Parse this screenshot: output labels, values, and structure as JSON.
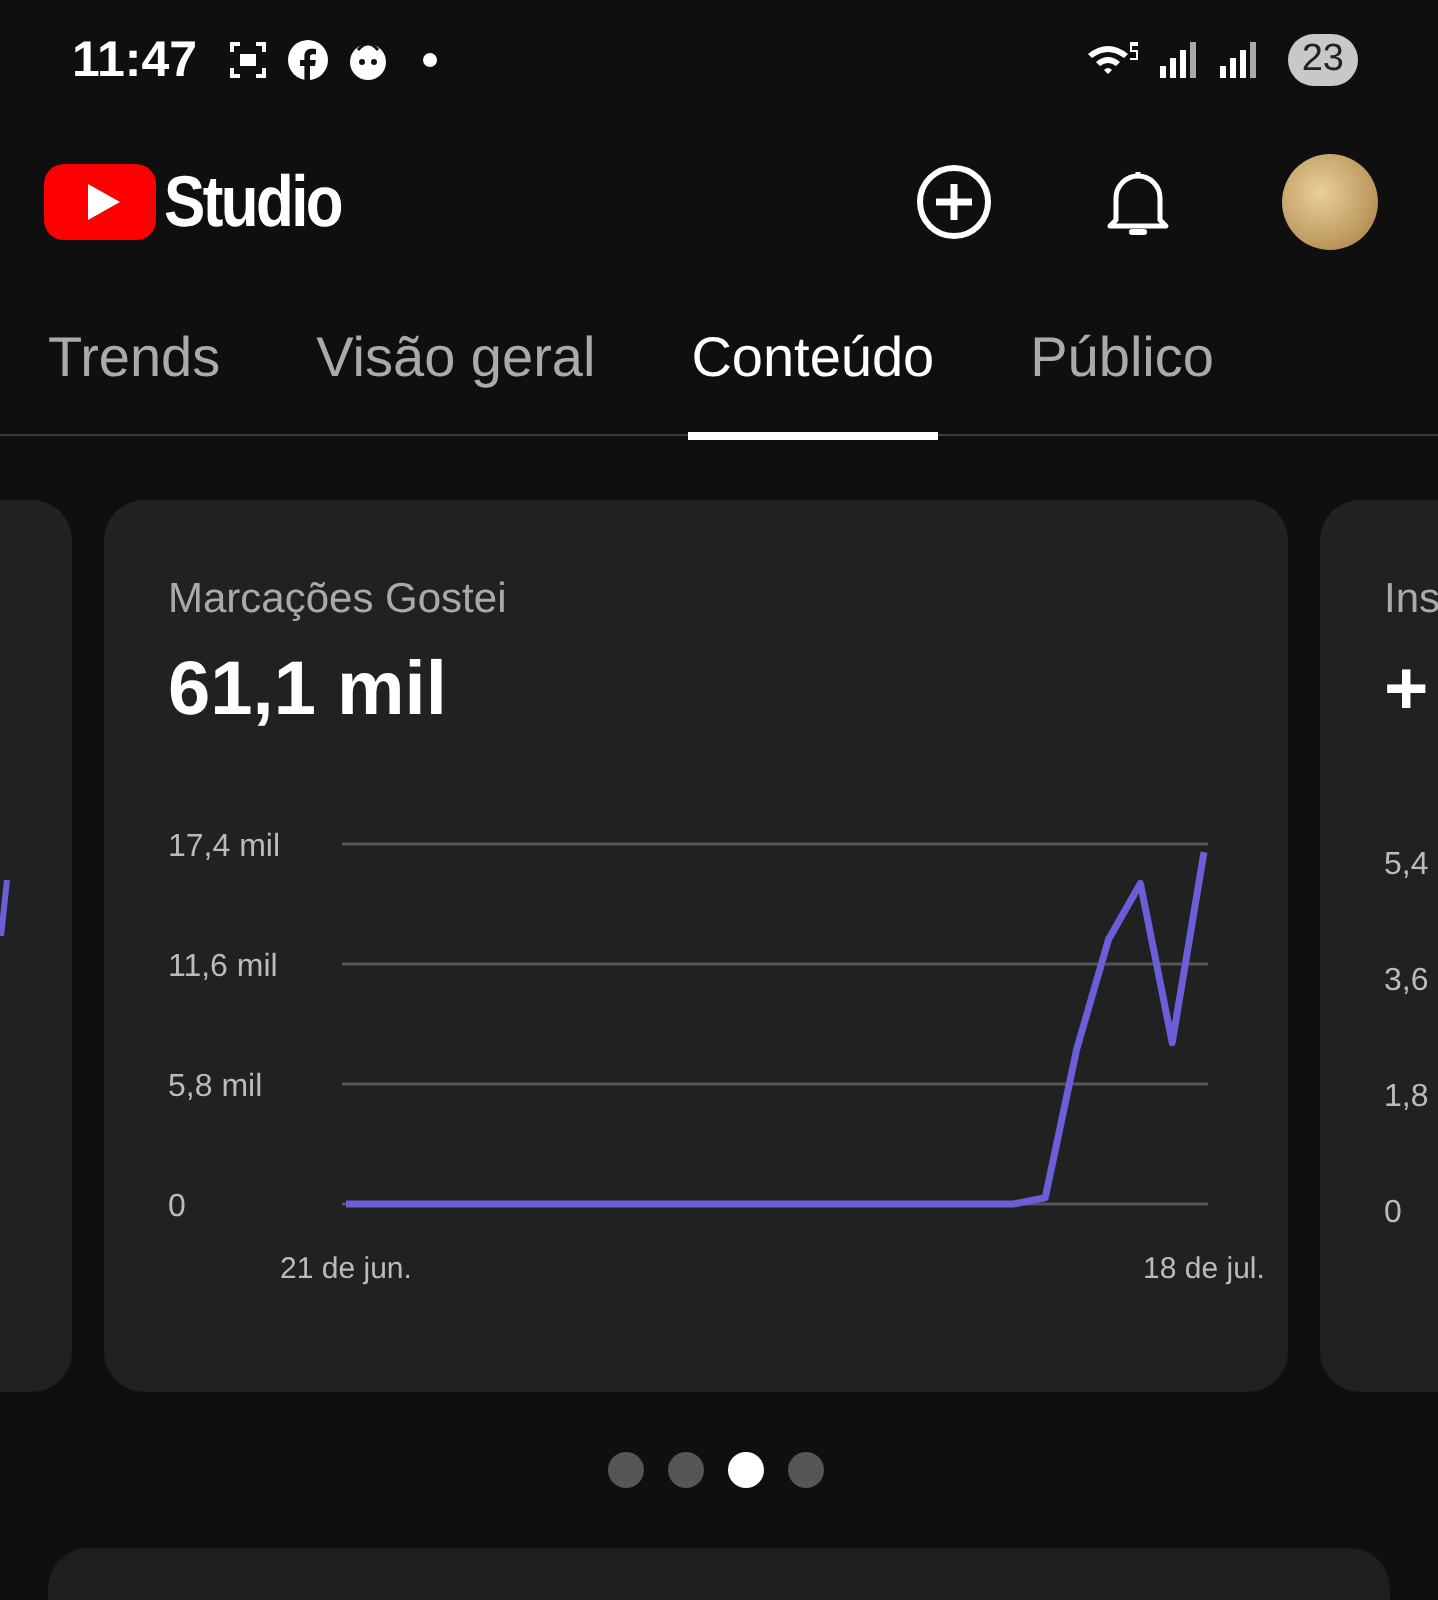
{
  "status_bar": {
    "time": "11:47",
    "battery": "23"
  },
  "header": {
    "title": "Studio"
  },
  "tabs": [
    {
      "label": "Trends",
      "selected": false
    },
    {
      "label": "Visão geral",
      "selected": false
    },
    {
      "label": "Conteúdo",
      "selected": true
    },
    {
      "label": "Público",
      "selected": false
    }
  ],
  "cards": [
    {
      "kind": "partial-left"
    },
    {
      "kind": "main",
      "title": "Marcações Gostei",
      "value": "61,1 mil",
      "chart_data": {
        "type": "line",
        "categories": [
          "21 de jun.",
          null,
          null,
          null,
          null,
          null,
          null,
          null,
          null,
          null,
          null,
          null,
          null,
          null,
          null,
          null,
          null,
          null,
          null,
          null,
          null,
          null,
          null,
          null,
          null,
          null,
          null,
          "18 de jul."
        ],
        "ylim": [
          0,
          17.4
        ],
        "yticks": [
          {
            "value": 0,
            "label": "0"
          },
          {
            "value": 5.8,
            "label": "5,8 mil"
          },
          {
            "value": 11.6,
            "label": "11,6 mil"
          },
          {
            "value": 17.4,
            "label": "17,4 mil"
          }
        ],
        "series": [
          {
            "color": "#6a5fd8",
            "values": [
              0,
              0,
              0,
              0,
              0,
              0,
              0,
              0,
              0,
              0,
              0,
              0,
              0,
              0,
              0,
              0,
              0,
              0,
              0,
              0,
              0,
              0,
              0.3,
              7.5,
              12.8,
              15.5,
              7.8,
              17.0
            ]
          }
        ]
      }
    },
    {
      "kind": "partial-right",
      "title": "Ins",
      "value": "+",
      "ticks": [
        "5,4",
        "3,6",
        "1,8",
        "0"
      ]
    }
  ],
  "pager": [
    {
      "selected": false
    },
    {
      "selected": false
    },
    {
      "selected": true
    },
    {
      "selected": false
    }
  ]
}
